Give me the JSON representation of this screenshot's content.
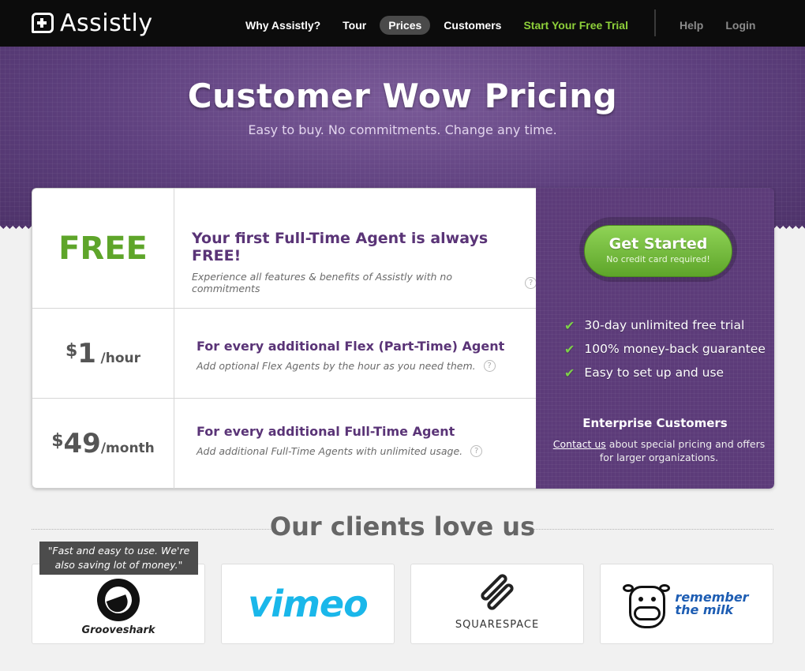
{
  "nav": {
    "logo_text": "Assistly",
    "links": [
      "Why Assistly?",
      "Tour",
      "Prices",
      "Customers",
      "Start Your Free Trial"
    ],
    "active": "Prices",
    "right_links": [
      "Help",
      "Login"
    ]
  },
  "hero": {
    "title": "Customer Wow Pricing",
    "subtitle": "Easy to buy. No commitments. Change any time."
  },
  "pricing": {
    "rows": [
      {
        "price": "FREE",
        "title": "Your first Full-Time Agent is always FREE!",
        "description": "Experience all features & benefits of Assistly with no commitments"
      },
      {
        "currency": "$",
        "amount": "1",
        "period": "/hour",
        "title": "For every additional Flex (Part-Time) Agent",
        "description": "Add optional Flex Agents by the hour as you need them."
      },
      {
        "currency": "$",
        "amount": "49",
        "period": "/month",
        "title": "For every additional Full-Time Agent",
        "description": "Add additional Full-Time Agents with unlimited usage."
      }
    ],
    "help_glyph": "?"
  },
  "cta": {
    "button_title": "Get Started",
    "button_sub": "No credit card required!",
    "benefits": [
      "30-day unlimited free trial",
      "100% money-back guarantee",
      "Easy to set up and use"
    ],
    "enterprise_title": "Enterprise Customers",
    "enterprise_link": "Contact us",
    "enterprise_text": " about special pricing and offers for larger organizations."
  },
  "clients": {
    "title": "Our clients love us",
    "testimonial": "\"Fast and easy to use. We're also saving lot of money.\"",
    "logos": [
      "Grooveshark",
      "vimeo",
      "SQUARESPACE",
      "remember",
      "the milk"
    ]
  },
  "colors": {
    "purple": "#5c3b79",
    "green": "#5ea52a",
    "nav_bg": "#0c0c0c"
  }
}
